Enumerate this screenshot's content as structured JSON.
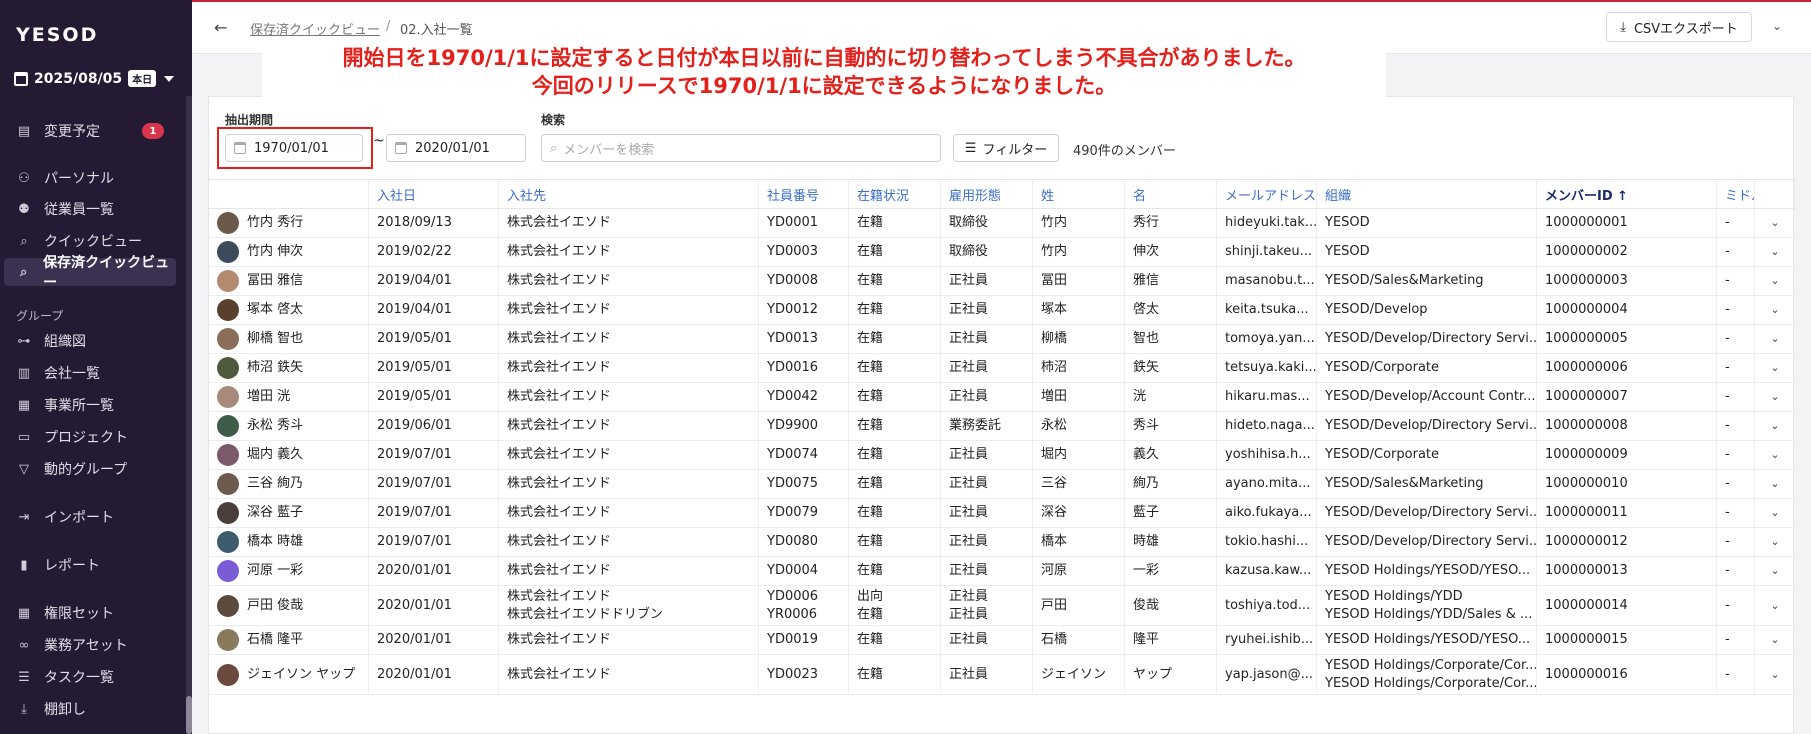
{
  "sidebar": {
    "logo": "YESOD",
    "date": "2025/08/05",
    "today": "本日",
    "items_top": [
      {
        "label": "変更予定",
        "icon": "doc-icon",
        "badge": "1"
      },
      {
        "label": "パーソナル",
        "icon": "person-icon"
      },
      {
        "label": "従業員一覧",
        "icon": "people-icon"
      },
      {
        "label": "クイックビュー",
        "icon": "search-icon"
      },
      {
        "label": "保存済クイックビュー",
        "icon": "search-icon",
        "active": true
      }
    ],
    "group_label": "グループ",
    "items_group": [
      {
        "label": "組織図",
        "icon": "org-icon"
      },
      {
        "label": "会社一覧",
        "icon": "company-icon"
      },
      {
        "label": "事業所一覧",
        "icon": "building-icon"
      },
      {
        "label": "プロジェクト",
        "icon": "briefcase-icon"
      },
      {
        "label": "動的グループ",
        "icon": "filter-icon"
      }
    ],
    "items_bottom": [
      {
        "label": "インポート",
        "icon": "import-icon"
      },
      {
        "label": "レポート",
        "icon": "chart-icon"
      },
      {
        "label": "権限セット",
        "icon": "grid-icon"
      },
      {
        "label": "業務アセット",
        "icon": "link-icon"
      },
      {
        "label": "タスク一覧",
        "icon": "list-icon"
      },
      {
        "label": "棚卸し",
        "icon": "download-icon"
      }
    ]
  },
  "header": {
    "breadcrumb_parent": "保存済クイックビュー",
    "breadcrumb_sep": "/",
    "breadcrumb_current": "02.入社一覧",
    "export_label": "CSVエクスポート"
  },
  "annotation": {
    "line1": "開始日を1970/1/1に設定すると日付が本日以前に自動的に切り替わってしまう不具合がありました。",
    "line2": "今回のリリースで1970/1/1に設定できるようになりました。"
  },
  "filters": {
    "period_label": "抽出期間",
    "start_date": "1970/01/01",
    "tilde": "~",
    "end_date": "2020/01/01",
    "search_label": "検索",
    "search_placeholder": "メンバーを検索",
    "filter_label": "フィルター",
    "member_count": "490件のメンバー"
  },
  "table": {
    "columns": [
      "",
      "入社日",
      "入社先",
      "社員番号",
      "在籍状況",
      "雇用形態",
      "姓",
      "名",
      "メールアドレス",
      "組織",
      "メンバーID ↑",
      "ミドル"
    ],
    "rows": [
      {
        "name": "竹内 秀行",
        "date": "2018/09/13",
        "company": [
          "株式会社イエソド"
        ],
        "emp": [
          "YD0001"
        ],
        "status": [
          "在籍"
        ],
        "type": [
          "取締役"
        ],
        "last": "竹内",
        "first": "秀行",
        "email": "hideyuki.tak...",
        "org": [
          "YESOD"
        ],
        "id": "1000000001",
        "mid": "-"
      },
      {
        "name": "竹内 伸次",
        "date": "2019/02/22",
        "company": [
          "株式会社イエソド"
        ],
        "emp": [
          "YD0003"
        ],
        "status": [
          "在籍"
        ],
        "type": [
          "取締役"
        ],
        "last": "竹内",
        "first": "伸次",
        "email": "shinji.takeu...",
        "org": [
          "YESOD"
        ],
        "id": "1000000002",
        "mid": "-"
      },
      {
        "name": "冨田 雅信",
        "date": "2019/04/01",
        "company": [
          "株式会社イエソド"
        ],
        "emp": [
          "YD0008"
        ],
        "status": [
          "在籍"
        ],
        "type": [
          "正社員"
        ],
        "last": "冨田",
        "first": "雅信",
        "email": "masanobu.t...",
        "org": [
          "YESOD/Sales&Marketing"
        ],
        "id": "1000000003",
        "mid": "-"
      },
      {
        "name": "塚本 啓太",
        "date": "2019/04/01",
        "company": [
          "株式会社イエソド"
        ],
        "emp": [
          "YD0012"
        ],
        "status": [
          "在籍"
        ],
        "type": [
          "正社員"
        ],
        "last": "塚本",
        "first": "啓太",
        "email": "keita.tsuka...",
        "org": [
          "YESOD/Develop"
        ],
        "id": "1000000004",
        "mid": "-"
      },
      {
        "name": "柳橋 智也",
        "date": "2019/05/01",
        "company": [
          "株式会社イエソド"
        ],
        "emp": [
          "YD0013"
        ],
        "status": [
          "在籍"
        ],
        "type": [
          "正社員"
        ],
        "last": "柳橋",
        "first": "智也",
        "email": "tomoya.yan...",
        "org": [
          "YESOD/Develop/Directory Servi..."
        ],
        "id": "1000000005",
        "mid": "-"
      },
      {
        "name": "柿沼 鉄矢",
        "date": "2019/05/01",
        "company": [
          "株式会社イエソド"
        ],
        "emp": [
          "YD0016"
        ],
        "status": [
          "在籍"
        ],
        "type": [
          "正社員"
        ],
        "last": "柿沼",
        "first": "鉄矢",
        "email": "tetsuya.kaki...",
        "org": [
          "YESOD/Corporate"
        ],
        "id": "1000000006",
        "mid": "-"
      },
      {
        "name": "増田 洸",
        "date": "2019/05/01",
        "company": [
          "株式会社イエソド"
        ],
        "emp": [
          "YD0042"
        ],
        "status": [
          "在籍"
        ],
        "type": [
          "正社員"
        ],
        "last": "増田",
        "first": "洸",
        "email": "hikaru.mas...",
        "org": [
          "YESOD/Develop/Account Contr..."
        ],
        "id": "1000000007",
        "mid": "-"
      },
      {
        "name": "永松 秀斗",
        "date": "2019/06/01",
        "company": [
          "株式会社イエソド"
        ],
        "emp": [
          "YD9900"
        ],
        "status": [
          "在籍"
        ],
        "type": [
          "業務委託"
        ],
        "last": "永松",
        "first": "秀斗",
        "email": "hideto.naga...",
        "org": [
          "YESOD/Develop/Directory Servi..."
        ],
        "id": "1000000008",
        "mid": "-"
      },
      {
        "name": "堀内 義久",
        "date": "2019/07/01",
        "company": [
          "株式会社イエソド"
        ],
        "emp": [
          "YD0074"
        ],
        "status": [
          "在籍"
        ],
        "type": [
          "正社員"
        ],
        "last": "堀内",
        "first": "義久",
        "email": "yoshihisa.h...",
        "org": [
          "YESOD/Corporate"
        ],
        "id": "1000000009",
        "mid": "-"
      },
      {
        "name": "三谷 絢乃",
        "date": "2019/07/01",
        "company": [
          "株式会社イエソド"
        ],
        "emp": [
          "YD0075"
        ],
        "status": [
          "在籍"
        ],
        "type": [
          "正社員"
        ],
        "last": "三谷",
        "first": "絢乃",
        "email": "ayano.mita...",
        "org": [
          "YESOD/Sales&Marketing"
        ],
        "id": "1000000010",
        "mid": "-"
      },
      {
        "name": "深谷 藍子",
        "date": "2019/07/01",
        "company": [
          "株式会社イエソド"
        ],
        "emp": [
          "YD0079"
        ],
        "status": [
          "在籍"
        ],
        "type": [
          "正社員"
        ],
        "last": "深谷",
        "first": "藍子",
        "email": "aiko.fukaya...",
        "org": [
          "YESOD/Develop/Directory Servi..."
        ],
        "id": "1000000011",
        "mid": "-"
      },
      {
        "name": "橋本 時雄",
        "date": "2019/07/01",
        "company": [
          "株式会社イエソド"
        ],
        "emp": [
          "YD0080"
        ],
        "status": [
          "在籍"
        ],
        "type": [
          "正社員"
        ],
        "last": "橋本",
        "first": "時雄",
        "email": "tokio.hashi...",
        "org": [
          "YESOD/Develop/Directory Servi..."
        ],
        "id": "1000000012",
        "mid": "-"
      },
      {
        "name": "河原 一彩",
        "date": "2020/01/01",
        "company": [
          "株式会社イエソド"
        ],
        "emp": [
          "YD0004"
        ],
        "status": [
          "在籍"
        ],
        "type": [
          "正社員"
        ],
        "last": "河原",
        "first": "一彩",
        "email": "kazusa.kaw...",
        "org": [
          "YESOD Holdings/YESOD/YESO..."
        ],
        "id": "1000000013",
        "mid": "-"
      },
      {
        "name": "戸田 俊哉",
        "date": "2020/01/01",
        "company": [
          "株式会社イエソド",
          "株式会社イエソドドリブン"
        ],
        "emp": [
          "YD0006",
          "YR0006"
        ],
        "status": [
          "出向",
          "在籍"
        ],
        "type": [
          "正社員",
          "正社員"
        ],
        "last": "戸田",
        "first": "俊哉",
        "email": "toshiya.tod...",
        "org": [
          "YESOD Holdings/YDD",
          "YESOD Holdings/YDD/Sales & ..."
        ],
        "id": "1000000014",
        "mid": "-"
      },
      {
        "name": "石橋 隆平",
        "date": "2020/01/01",
        "company": [
          "株式会社イエソド"
        ],
        "emp": [
          "YD0019"
        ],
        "status": [
          "在籍"
        ],
        "type": [
          "正社員"
        ],
        "last": "石橋",
        "first": "隆平",
        "email": "ryuhei.ishib...",
        "org": [
          "YESOD Holdings/YESOD/YESO..."
        ],
        "id": "1000000015",
        "mid": "-"
      },
      {
        "name": "ジェイソン ヤップ",
        "date": "2020/01/01",
        "company": [
          "株式会社イエソド"
        ],
        "emp": [
          "YD0023"
        ],
        "status": [
          "在籍"
        ],
        "type": [
          "正社員"
        ],
        "last": "ジェイソン",
        "first": "ヤップ",
        "email": "yap.jason@...",
        "org": [
          "YESOD Holdings/Corporate/Cor...",
          "YESOD Holdings/Corporate/Cor..."
        ],
        "id": "1000000016",
        "mid": "-"
      }
    ]
  },
  "colors": {
    "sidebar_bg": "#241a33",
    "accent_red": "#e2211c",
    "header_link": "#3c6ec8"
  }
}
